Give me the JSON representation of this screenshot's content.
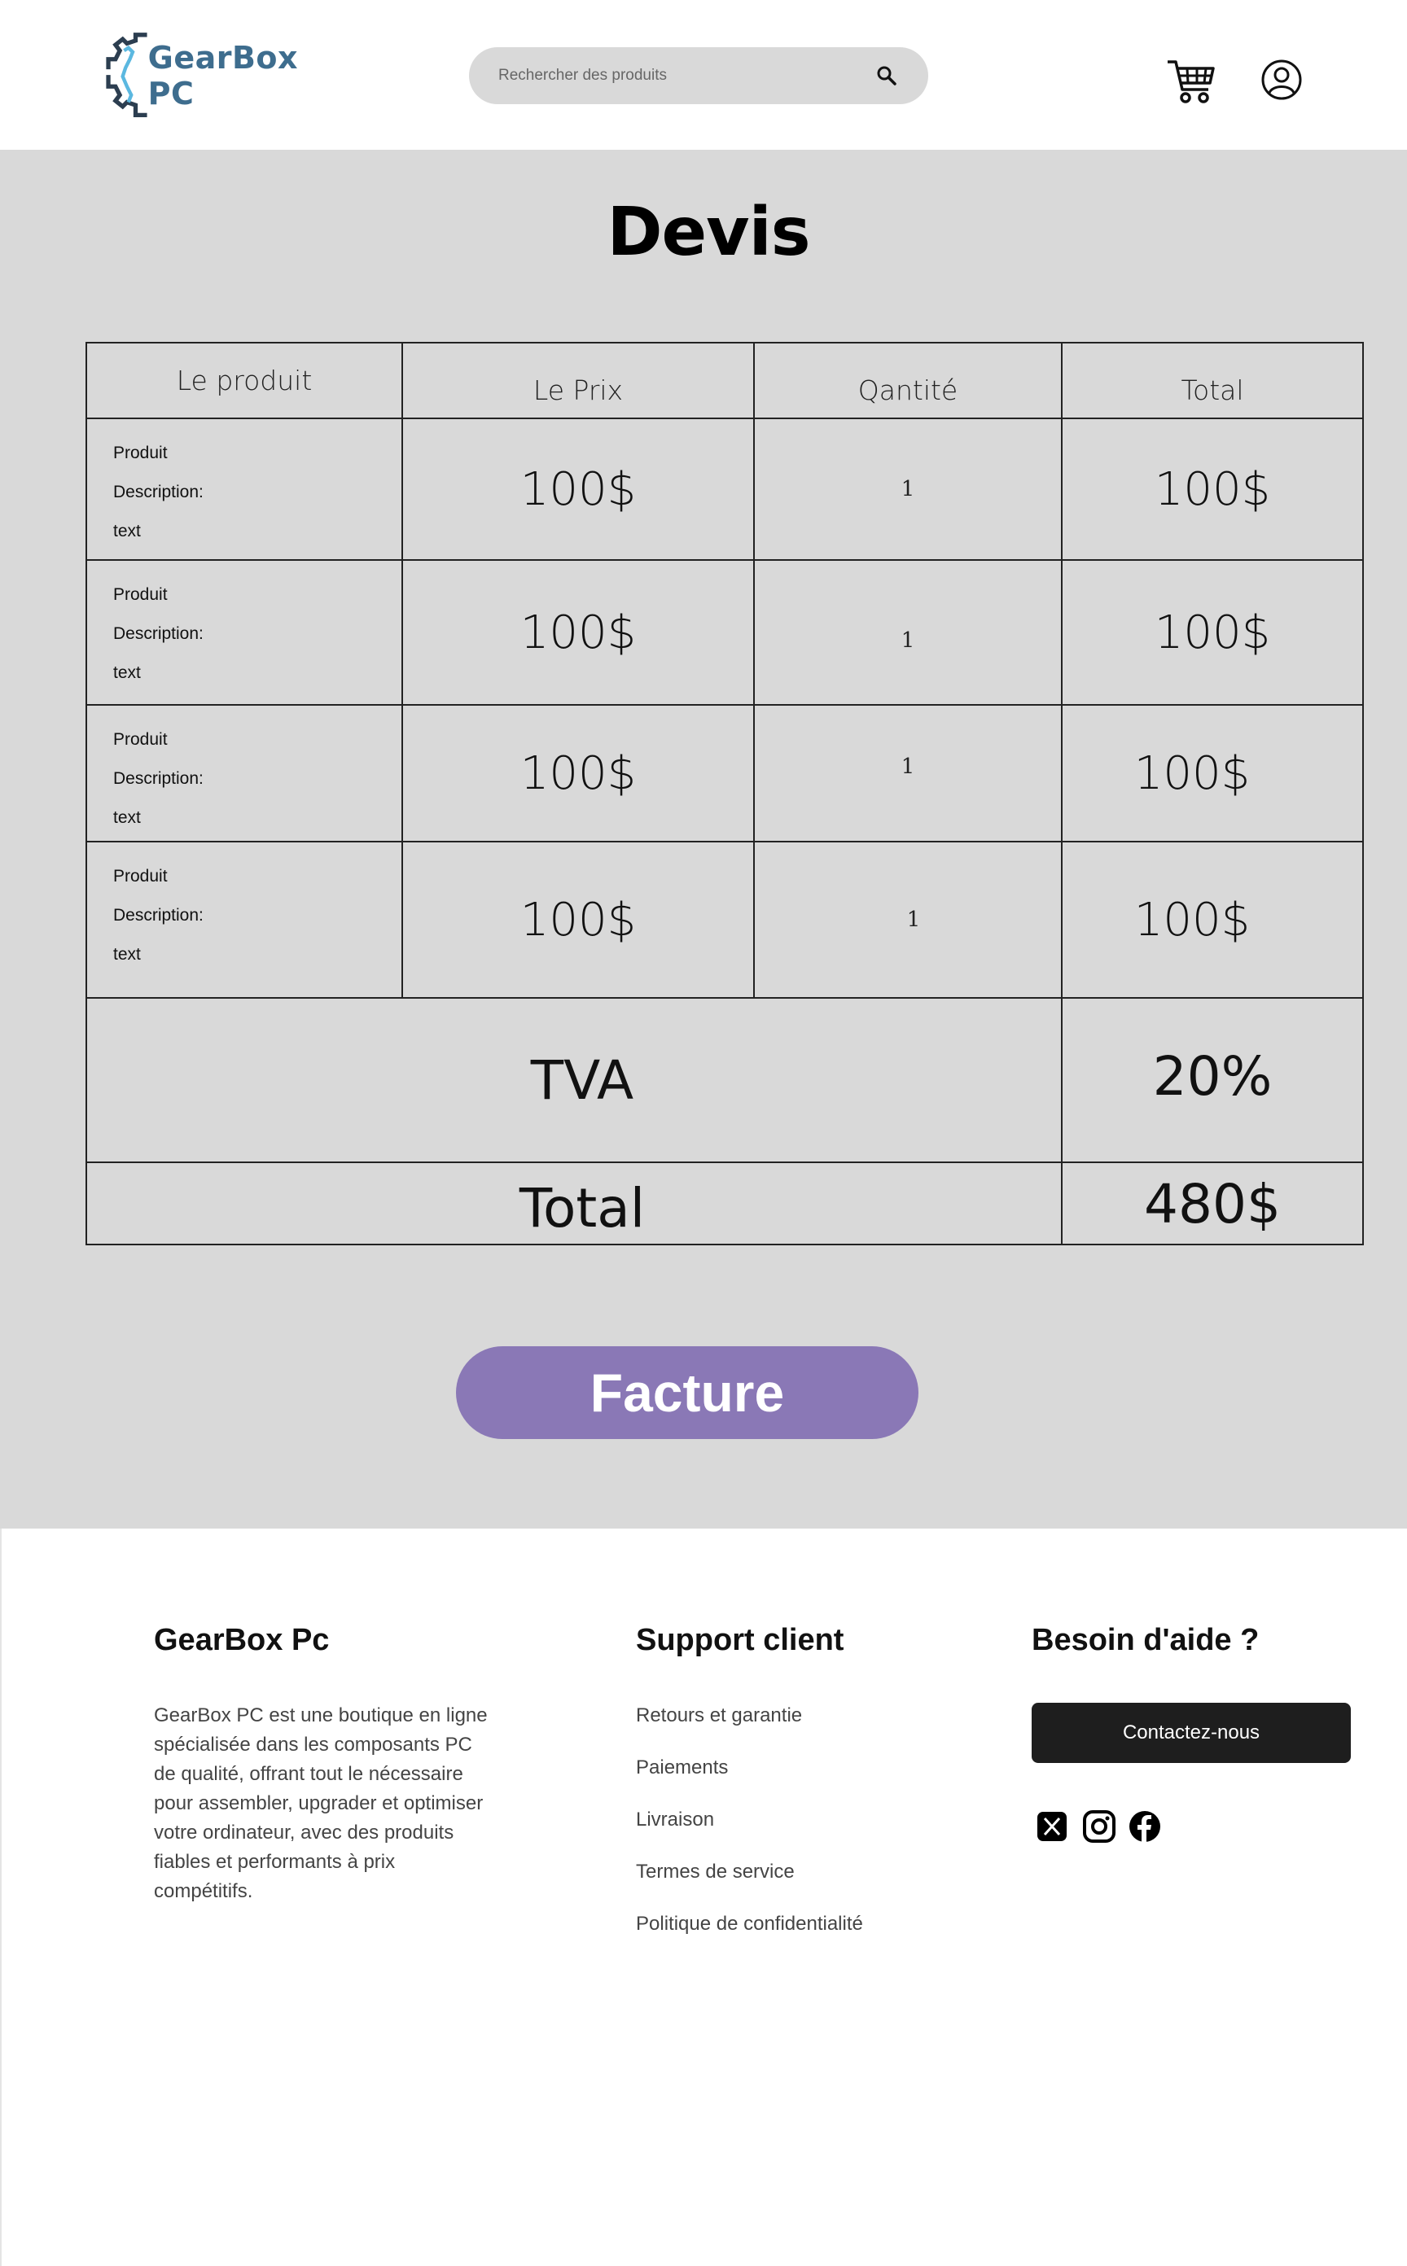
{
  "header": {
    "brand": "GearBox PC",
    "search_placeholder": "Rechercher des produits"
  },
  "page": {
    "title": "Devis"
  },
  "table": {
    "columns": [
      "Le produit",
      "Le Prix",
      "Qantité",
      "Total"
    ],
    "rows": [
      {
        "line1": "Produit",
        "line2": "Description:",
        "line3": "text",
        "price": "100$",
        "qty": "1",
        "total": "100$"
      },
      {
        "line1": "Produit",
        "line2": "Description:",
        "line3": "text",
        "price": "100$",
        "qty": "1",
        "total": "100$"
      },
      {
        "line1": "Produit",
        "line2": "Description:",
        "line3": "text",
        "price": "100$",
        "qty": "1",
        "total": "100$"
      },
      {
        "line1": "Produit",
        "line2": "Description:",
        "line3": "text",
        "price": "100$",
        "qty": "1",
        "total": "100$"
      }
    ],
    "tva_label": "TVA",
    "tva_value": "20%",
    "total_label": "Total",
    "total_value": "480$"
  },
  "actions": {
    "invoice_label": "Facture"
  },
  "footer": {
    "brand_title": "GearBox Pc",
    "brand_description": "GearBox PC est une boutique en ligne spécialisée dans les composants PC de qualité, offrant tout le nécessaire pour assembler, upgrader et optimiser votre ordinateur, avec des produits fiables et performants à prix compétitifs.",
    "support_title": "Support client",
    "support_links": [
      "Retours et garantie",
      "Paiements",
      "Livraison",
      "Termes de service",
      "Politique de confidentialité"
    ],
    "help_title": "Besoin d'aide ?",
    "contact_label": "Contactez-nous",
    "social_icons": [
      "x-icon",
      "instagram-icon",
      "facebook-icon"
    ]
  },
  "colors": {
    "brand": "#3e6d8e",
    "invoice_button": "#8a78b6",
    "main_background": "#d9d9d9",
    "contact_button": "#1e1e1e"
  }
}
